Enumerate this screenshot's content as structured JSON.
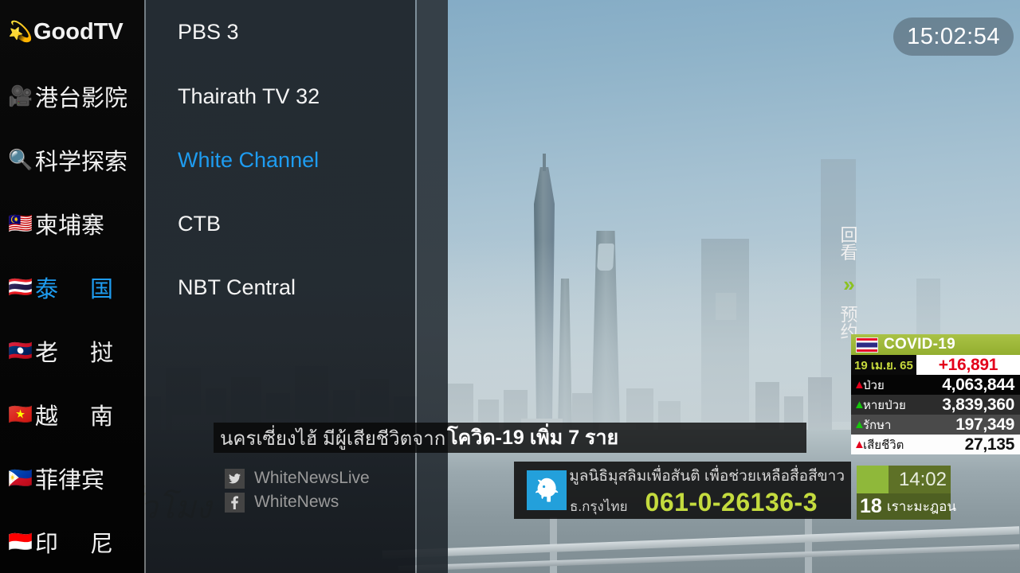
{
  "sidebar": {
    "items": [
      {
        "icon": "comet-icon",
        "glyph": "💫",
        "label": "GoodTV",
        "selected": false,
        "style": "brand"
      },
      {
        "icon": "movie-camera-icon",
        "glyph": "🎥",
        "label": "港台影院",
        "selected": false,
        "style": "normal"
      },
      {
        "icon": "magnifier-icon",
        "glyph": "🔍",
        "label": "科学探索",
        "selected": false,
        "style": "normal"
      },
      {
        "icon": "flag-malaysia-icon",
        "glyph": "🇲🇾",
        "label": "柬埔寨",
        "selected": false,
        "style": "normal"
      },
      {
        "icon": "flag-thailand-icon",
        "glyph": "🇹🇭",
        "label": "泰 国",
        "selected": true,
        "style": "spaced"
      },
      {
        "icon": "flag-laos-icon",
        "glyph": "🇱🇦",
        "label": "老 挝",
        "selected": false,
        "style": "spaced"
      },
      {
        "icon": "flag-vietnam-icon",
        "glyph": "🇻🇳",
        "label": "越 南",
        "selected": false,
        "style": "spaced"
      },
      {
        "icon": "flag-philippines-icon",
        "glyph": "🇵🇭",
        "label": "菲律宾",
        "selected": false,
        "style": "normal"
      },
      {
        "icon": "flag-indonesia-icon",
        "glyph": "🇮🇩",
        "label": "印 尼",
        "selected": false,
        "style": "spaced"
      }
    ]
  },
  "channels": {
    "items": [
      {
        "label": "PBS 3",
        "selected": false
      },
      {
        "label": "Thairath TV 32",
        "selected": false
      },
      {
        "label": "White Channel",
        "selected": true
      },
      {
        "label": "CTB",
        "selected": false
      },
      {
        "label": "NBT Central",
        "selected": false
      }
    ]
  },
  "sidepad": {
    "replay_label": "回看",
    "chevron_glyph": "»",
    "reserve_label": "预约"
  },
  "clock": {
    "time": "15:02:54"
  },
  "covid": {
    "title": "COVID-19",
    "flag": "flag-thailand-icon",
    "date": "19 เม.ย. 65",
    "new_cases": "+16,891",
    "rows": [
      {
        "arrow": "up-red",
        "label": "ป่วย",
        "value": "4,063,844"
      },
      {
        "arrow": "up-green",
        "label": "หายป่วย",
        "value": "3,839,360"
      },
      {
        "arrow": "up-green",
        "label": "รักษา",
        "value": "197,349"
      },
      {
        "arrow": "up-red",
        "label": "เสียชีวิต",
        "value": "27,135"
      }
    ]
  },
  "program": {
    "time": "14:02",
    "progress_percent": 34,
    "number": "18",
    "name": "เราะมะฎอน"
  },
  "ticker": {
    "text_normal": "นครเซี่ยงไฮ้ มีผู้เสียชีวิตจาก",
    "text_bold": "โควิด-19 เพิ่ม 7 ราย"
  },
  "social": {
    "twitter": {
      "icon": "twitter-icon",
      "glyph": "🐦",
      "handle": "WhiteNewsLive"
    },
    "facebook": {
      "icon": "facebook-icon",
      "glyph": "f",
      "handle": "WhiteNews"
    }
  },
  "bank": {
    "logo": "krungthai-bank-logo",
    "logo_glyph": "🕊",
    "title": "มูลนิธิมุสลิมเพื่อสันติ เพื่อช่วยเหลือสื่อสีขาว",
    "bank_name": "ธ.กรุงไทย",
    "account": "061-0-26136-3"
  },
  "watermark": {
    "text": "ต้นชั่วโมง"
  },
  "colors": {
    "accent_blue": "#1e9cf0",
    "covid_header_green": "#a9c245",
    "progress_green": "#8fb83a",
    "account_green": "#c4db3e",
    "alert_red": "#e3001b",
    "up_green": "#16c60c"
  }
}
